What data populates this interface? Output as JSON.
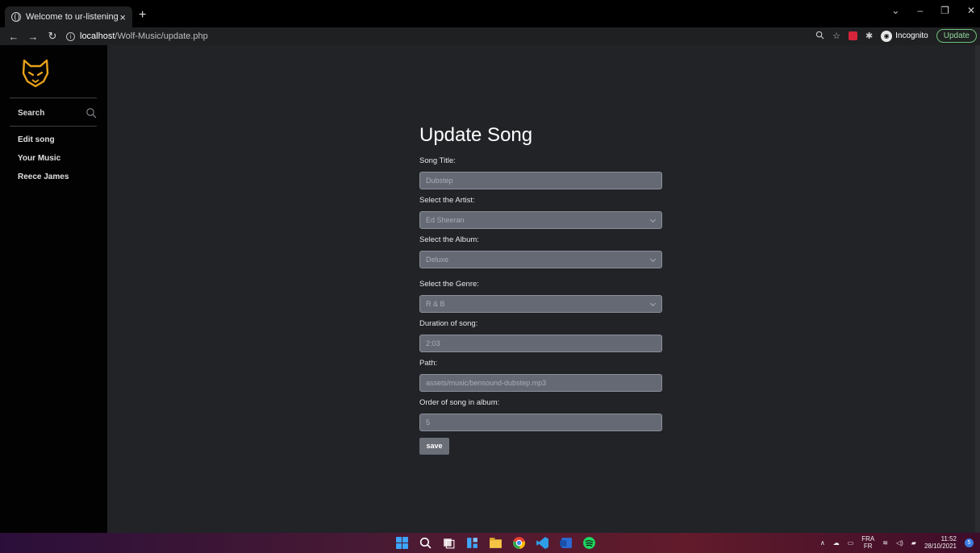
{
  "browser": {
    "tab_title": "Welcome to ur-listening",
    "tab_close": "×",
    "new_tab": "+",
    "url_host": "localhost",
    "url_path": "/Wolf-Music/update.php",
    "incognito_label": "Incognito",
    "update_label": "Update",
    "window_controls": [
      "⌄",
      "–",
      "❐",
      "✕"
    ]
  },
  "sidebar": {
    "search_label": "Search",
    "items": [
      {
        "label": "Edit song"
      },
      {
        "label": "Your Music"
      },
      {
        "label": "Reece James"
      }
    ]
  },
  "form": {
    "title": "Update Song",
    "fields": [
      {
        "label": "Song Title:",
        "value": "Dubstep",
        "type": "text"
      },
      {
        "label": "Select the Artist:",
        "value": "Ed Sheeran",
        "type": "select"
      },
      {
        "label": "Select the Album:",
        "value": "Deluxe",
        "type": "select"
      },
      {
        "label": "Select the Genre:",
        "value": "R & B",
        "type": "select"
      },
      {
        "label": "Duration of song:",
        "value": "2:03",
        "type": "text"
      },
      {
        "label": "Path:",
        "value": "assets/music/bensound-dubstep.mp3",
        "type": "text"
      },
      {
        "label": "Order of song in album:",
        "value": "5",
        "type": "text"
      }
    ],
    "save_label": "save"
  },
  "taskbar": {
    "lang_top": "FRA",
    "lang_bottom": "FR",
    "time": "11:52",
    "date": "28/10/2021",
    "notification_count": "5"
  },
  "colors": {
    "page_bg": "#212327",
    "sidebar_bg": "#020202",
    "logo_accent": "#e8a21a",
    "field_bg": "#656974"
  }
}
